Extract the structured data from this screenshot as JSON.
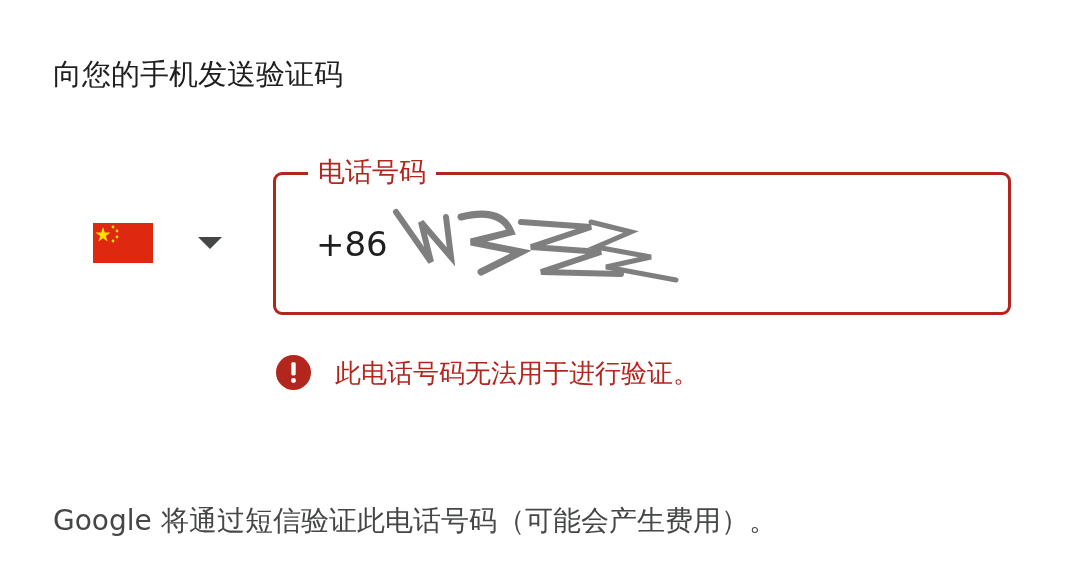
{
  "heading": "向您的手机发送验证码",
  "phone_field": {
    "label": "电话号码",
    "value": "+86",
    "error": true
  },
  "error_message": "此电话号码无法用于进行验证。",
  "note": "Google 将通过短信验证此电话号码（可能会产生费用）。"
}
